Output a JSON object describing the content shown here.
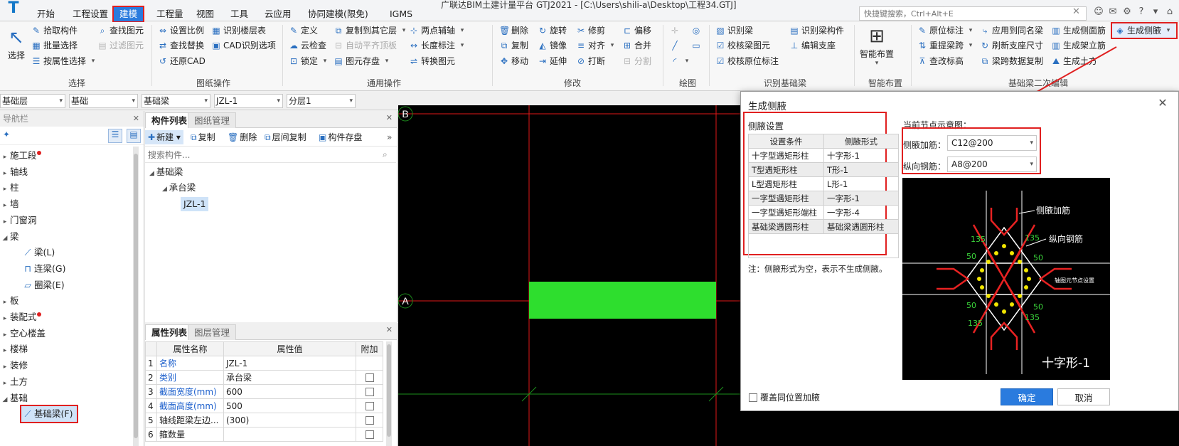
{
  "window": {
    "title": "广联达BIM土建计量平台 GTJ2021 - [C:\\Users\\shili-a\\Desktop\\工程34.GTJ]"
  },
  "menu": {
    "items": [
      "开始",
      "工程设置",
      "建模",
      "工程量",
      "视图",
      "工具",
      "云应用",
      "协同建模(限免)",
      "IGMS"
    ],
    "active": "建模",
    "search_placeholder": "快捷键搜索，Ctrl+Alt+E"
  },
  "ribbon": {
    "select": {
      "big": "选择",
      "items": [
        "拾取构件",
        "批量选择",
        "按属性选择",
        "查找图元",
        "过滤图元"
      ],
      "label": "选择"
    },
    "drawing_ops": {
      "items": [
        "设置比例",
        "查找替换",
        "还原CAD",
        "识别楼层表",
        "CAD识别选项"
      ],
      "label": "图纸操作"
    },
    "common_ops": {
      "items": [
        "定义",
        "云检查",
        "锁定",
        "复制到其它层",
        "自动平齐顶板",
        "图元存盘",
        "两点辅轴",
        "长度标注",
        "转换图元"
      ],
      "label": "通用操作"
    },
    "modify": {
      "items": [
        "删除",
        "复制",
        "移动",
        "旋转",
        "镜像",
        "延伸",
        "修剪",
        "对齐",
        "打断",
        "偏移",
        "合并",
        "分割"
      ],
      "label": "修改"
    },
    "draw": {
      "label": "绘图"
    },
    "recognize": {
      "items": [
        "识别梁",
        "校核梁图元",
        "校核原位标注",
        "识别梁构件",
        "编辑支座"
      ],
      "label": "识别基础梁"
    },
    "smart": {
      "big": "智能布置",
      "label": "智能布置"
    },
    "secondary": {
      "items": [
        "原位标注",
        "重提梁跨",
        "查改标高",
        "应用到同名梁",
        "刷新支座尺寸",
        "梁跨数据复制",
        "生成侧面筋",
        "生成架立筋",
        "生成土方",
        "生成侧腋"
      ],
      "label": "基础梁二次编辑"
    }
  },
  "selectors": [
    "基础层",
    "基础",
    "基础梁",
    "JZL-1",
    "分层1"
  ],
  "nav": {
    "title": "导航栏",
    "items": [
      {
        "label": "施工段",
        "dot": true
      },
      {
        "label": "轴线"
      },
      {
        "label": "柱"
      },
      {
        "label": "墙"
      },
      {
        "label": "门窗洞"
      },
      {
        "label": "梁",
        "open": true
      }
    ],
    "beam_children": [
      "梁(L)",
      "连梁(G)",
      "圈梁(E)"
    ],
    "items2": [
      {
        "label": "板"
      },
      {
        "label": "装配式",
        "dot": true
      },
      {
        "label": "空心楼盖"
      },
      {
        "label": "楼梯"
      },
      {
        "label": "装修"
      },
      {
        "label": "土方"
      },
      {
        "label": "基础",
        "open": true
      }
    ],
    "foundation_child": "基础梁(F)"
  },
  "component_list": {
    "tabs": [
      "构件列表",
      "图纸管理"
    ],
    "toolbar": [
      "新建",
      "复制",
      "删除",
      "层间复制",
      "构件存盘"
    ],
    "search_placeholder": "搜索构件...",
    "tree": {
      "root": "基础梁",
      "child": "承台梁",
      "leaf": "JZL-1"
    }
  },
  "properties": {
    "tabs": [
      "属性列表",
      "图层管理"
    ],
    "headers": [
      "属性名称",
      "属性值",
      "附加"
    ],
    "rows": [
      {
        "no": "1",
        "name": "名称",
        "value": "JZL-1",
        "blue": true,
        "check": false
      },
      {
        "no": "2",
        "name": "类别",
        "value": "承台梁",
        "blue": true,
        "check": true
      },
      {
        "no": "3",
        "name": "截面宽度(mm)",
        "value": "600",
        "blue": true,
        "check": true
      },
      {
        "no": "4",
        "name": "截面高度(mm)",
        "value": "500",
        "blue": true,
        "check": true
      },
      {
        "no": "5",
        "name": "轴线距梁左边...",
        "value": "(300)",
        "blue": false,
        "check": true
      },
      {
        "no": "6",
        "name": "箍数量",
        "value": "",
        "blue": false,
        "check": true
      }
    ]
  },
  "canvas": {
    "axis_b": "B",
    "axis_a": "A"
  },
  "dialog": {
    "title": "生成侧腋",
    "settings_title": "侧腋设置",
    "table_headers": [
      "设置条件",
      "侧腋形式"
    ],
    "table_rows": [
      [
        "十字型遇矩形柱",
        "十字形-1"
      ],
      [
        "T型遇矩形柱",
        "T形-1"
      ],
      [
        "L型遇矩形柱",
        "L形-1"
      ],
      [
        "一字型遇矩形柱",
        "一字形-1"
      ],
      [
        "一字型遇矩形端柱",
        "一字形-4"
      ],
      [
        "基础梁遇圆形柱",
        "基础梁遇圆形柱"
      ]
    ],
    "note": "注：侧腋形式为空，表示不生成侧腋。",
    "node_label": "当前节点示意图：",
    "haunch_rebar_label": "侧腋加筋：",
    "haunch_rebar_value": "C12@200",
    "long_rebar_label": "纵向钢筋：",
    "long_rebar_value": "A8@200",
    "diagram": {
      "label_haunch": "侧腋加筋",
      "label_long": "纵向钢筋",
      "dim_135": "135",
      "dim_50": "50",
      "side_text": "轴图元节点设置",
      "shape_name": "十字形-1"
    },
    "cover_label": "覆盖同位置加腋",
    "ok": "确定",
    "cancel": "取消"
  },
  "colors": {
    "accent": "#2a7bde",
    "highlight": "#e02020",
    "beam_green": "#2ede2e",
    "axis_red": "#e01818"
  }
}
